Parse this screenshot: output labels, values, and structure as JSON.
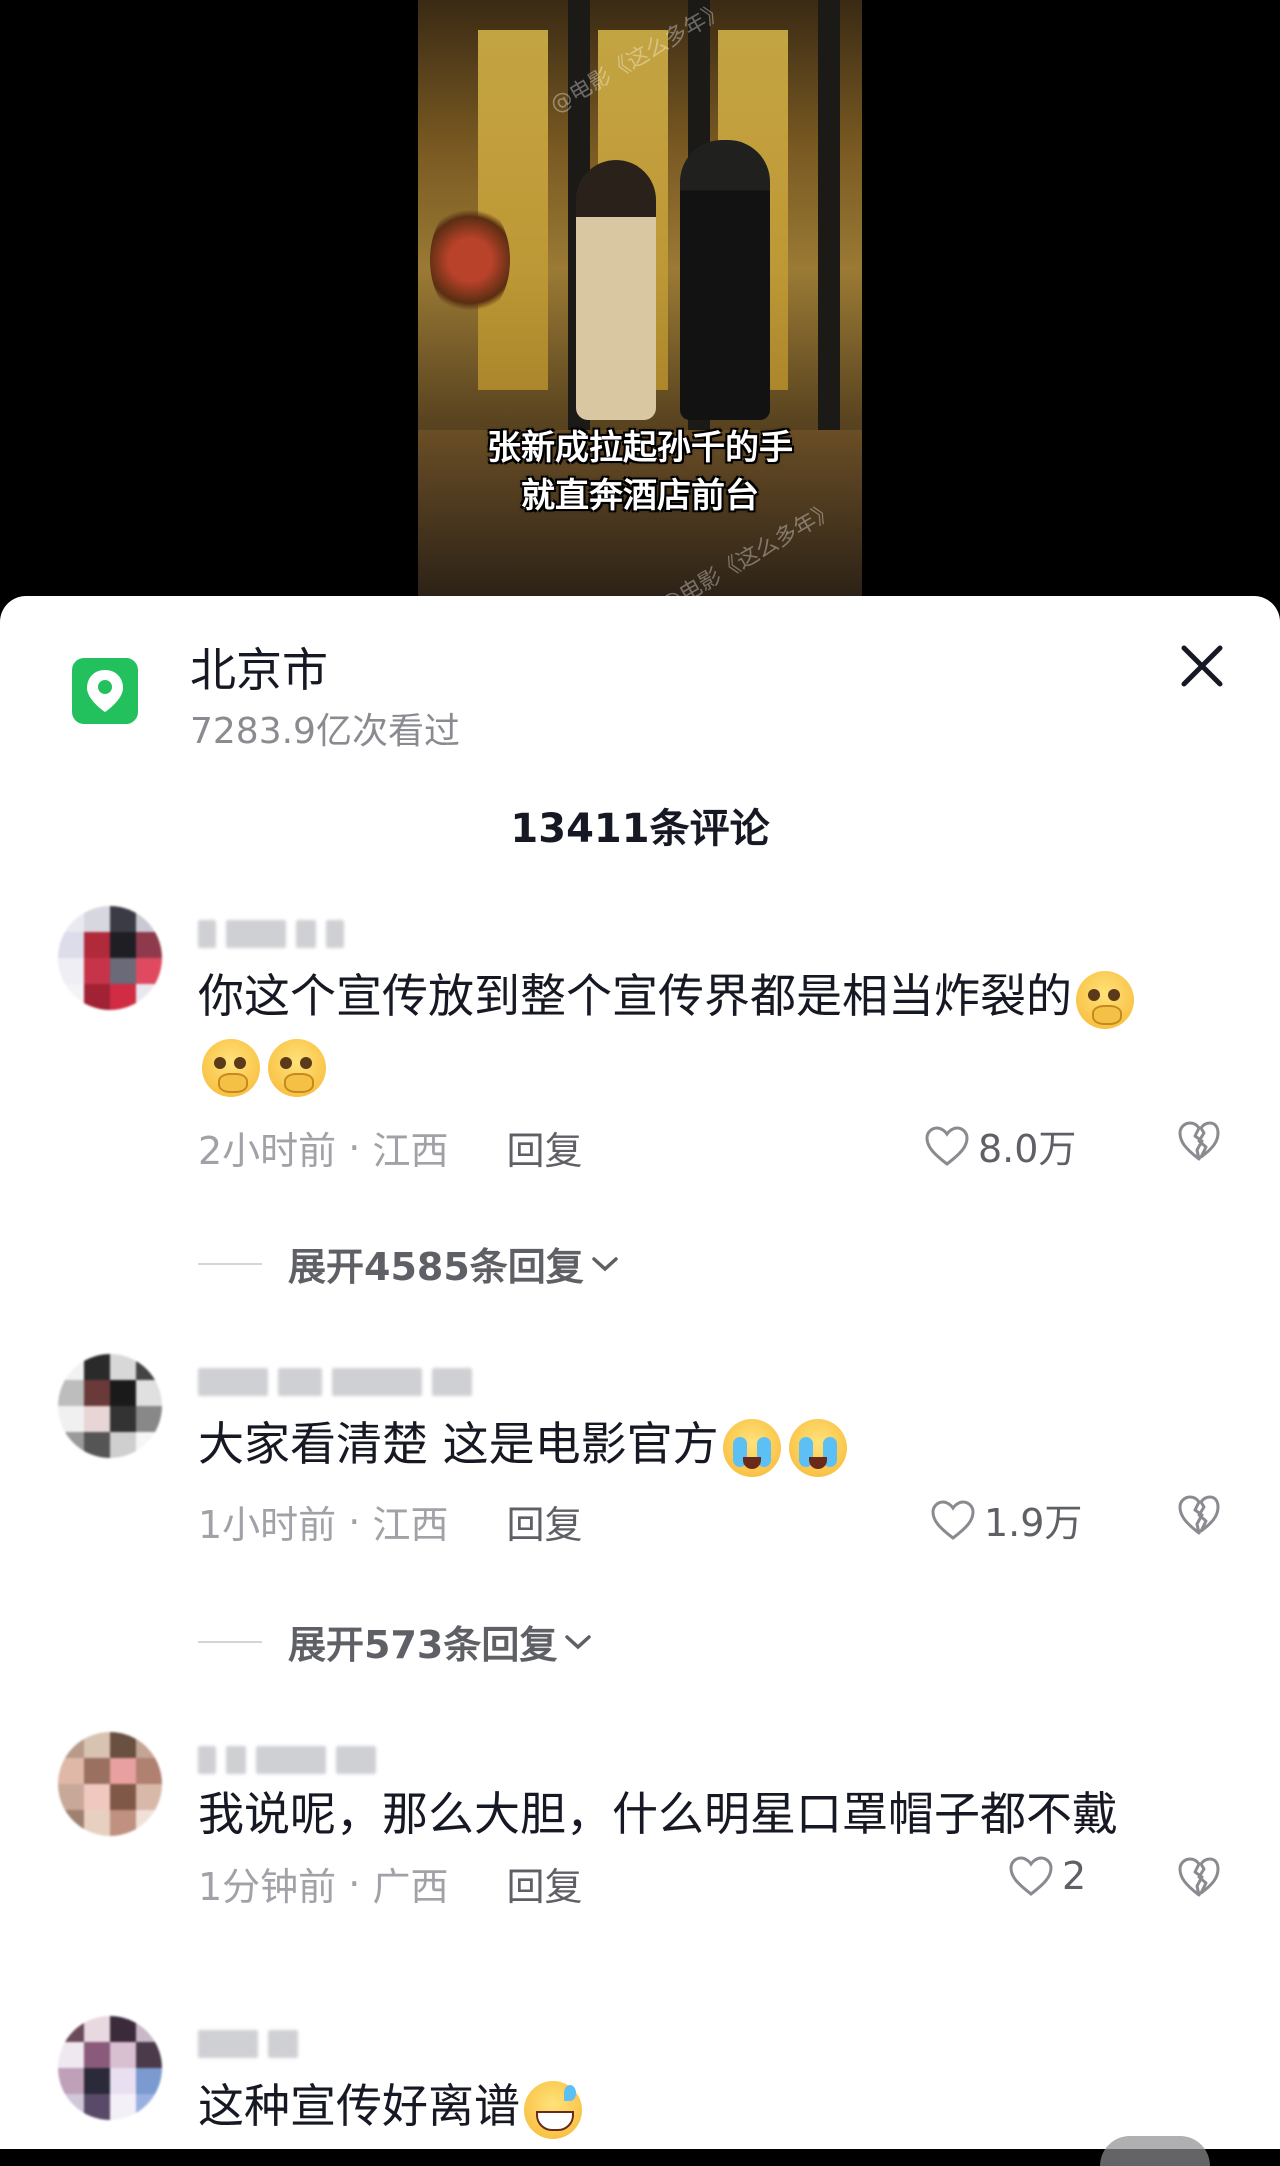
{
  "video": {
    "caption_line1": "张新成拉起孙千的手",
    "caption_line2": "就直奔酒店前台",
    "watermark_1": "@电影《这么多年》",
    "watermark_2": "@电影《这么多年》"
  },
  "sheet": {
    "location_title": "北京市",
    "location_views": "7283.9亿次看过",
    "comment_count": "13411条评论",
    "accent_color": "#23c15d"
  },
  "comments": [
    {
      "text": "你这个宣传放到整个宣传界都是相当炸裂的",
      "emojis": [
        "pleading-face",
        "pleading-face",
        "pleading-face"
      ],
      "time": "2小时前",
      "location": "江西",
      "reply_label": "回复",
      "likes": "8.0万",
      "expand_label": "展开4585条回复"
    },
    {
      "text": "大家看清楚 这是电影官方",
      "emojis": [
        "crying-face",
        "crying-face"
      ],
      "time": "1小时前",
      "location": "江西",
      "reply_label": "回复",
      "likes": "1.9万",
      "expand_label": "展开573条回复"
    },
    {
      "text": "我说呢，那么大胆，什么明星口罩帽子都不戴",
      "time": "1分钟前",
      "location": "广西",
      "reply_label": "回复",
      "likes": "2"
    },
    {
      "text": "这种宣传好离谱",
      "emojis": [
        "grinning-sweat-face"
      ]
    }
  ]
}
